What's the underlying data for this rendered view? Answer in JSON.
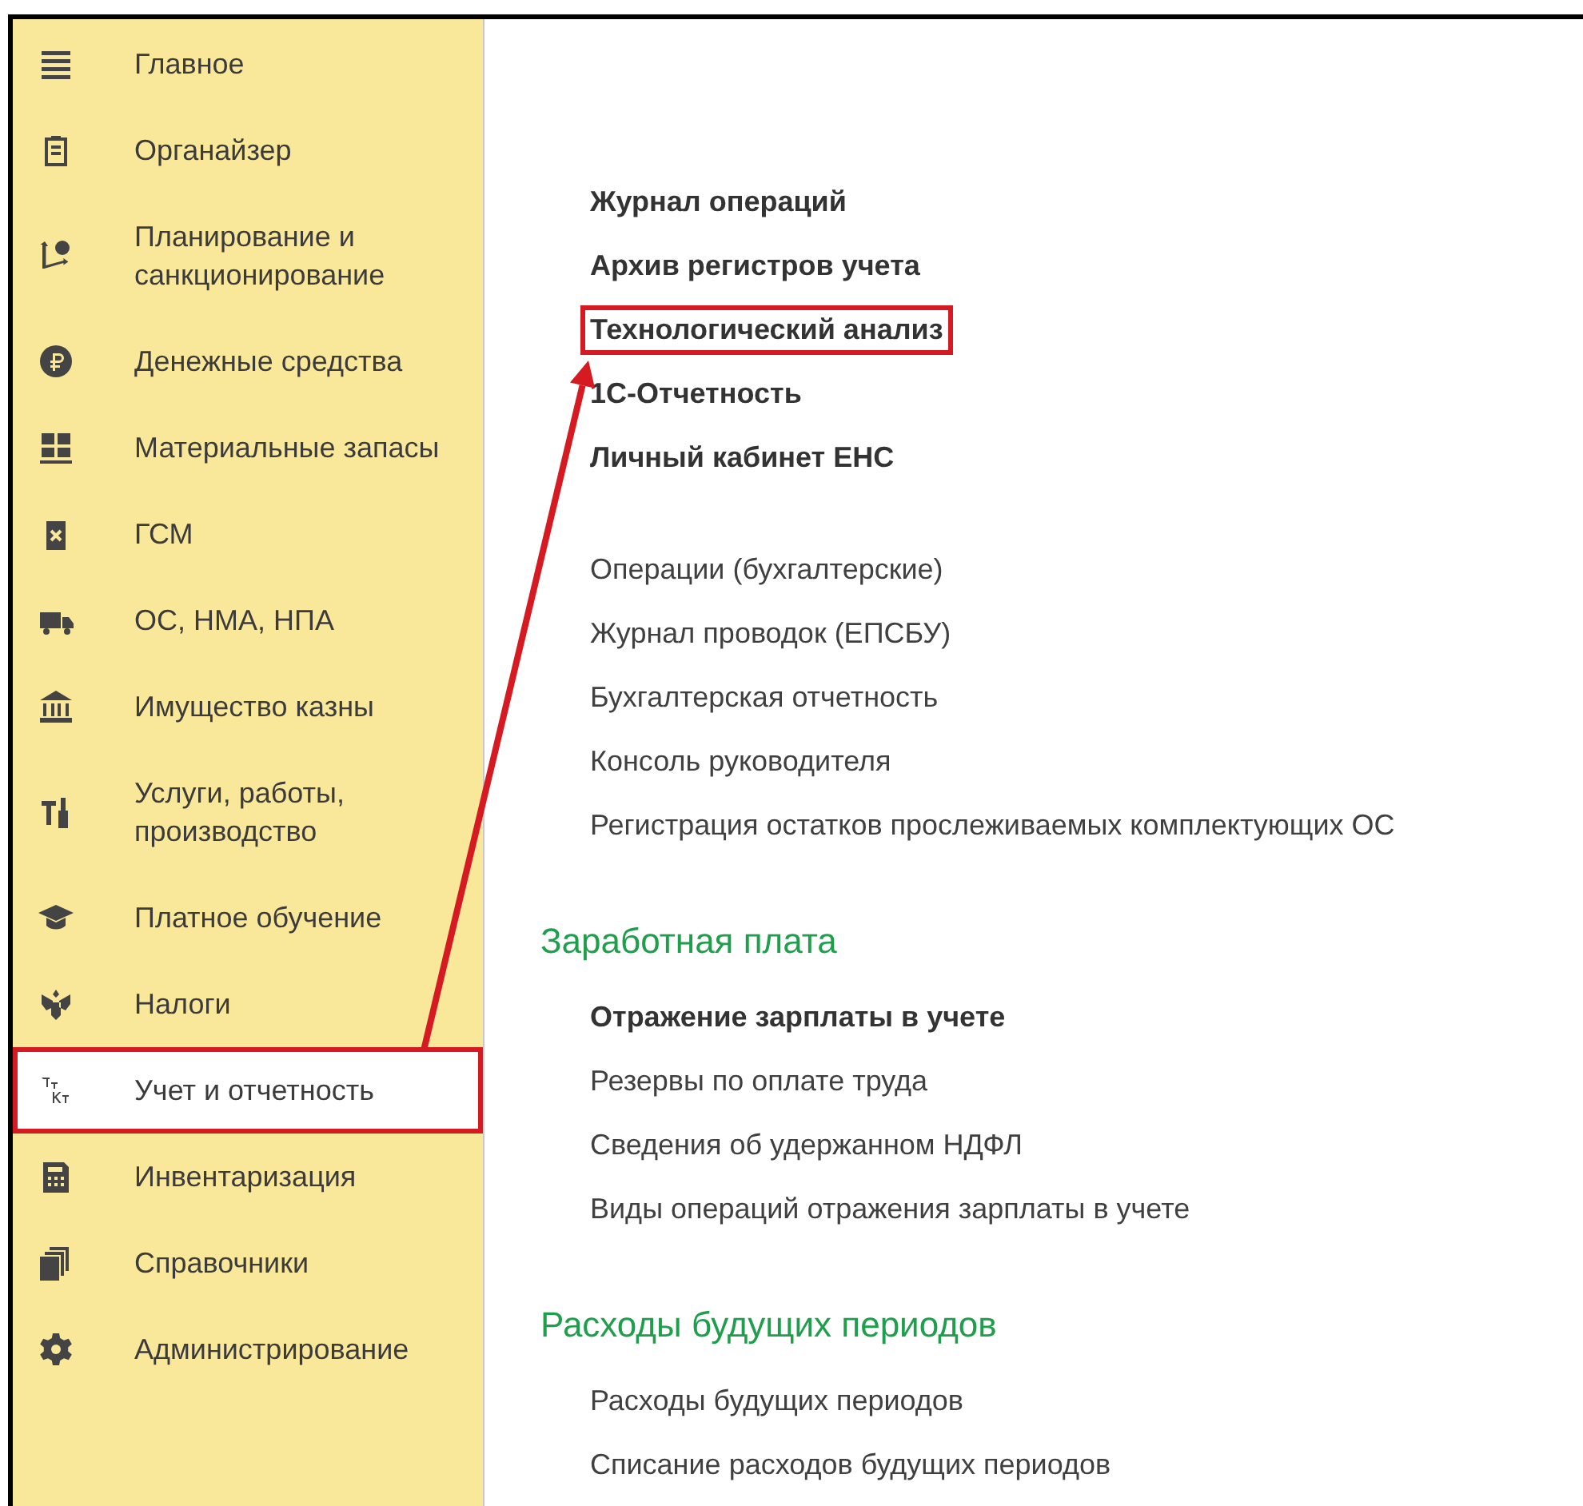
{
  "sidebar": {
    "items": [
      {
        "label": "Главное",
        "selected": false,
        "highlighted": false
      },
      {
        "label": "Органайзер",
        "selected": false,
        "highlighted": false
      },
      {
        "label": "Планирование и санкционирование",
        "selected": false,
        "highlighted": false
      },
      {
        "label": "Денежные средства",
        "selected": false,
        "highlighted": false
      },
      {
        "label": "Материальные запасы",
        "selected": false,
        "highlighted": false
      },
      {
        "label": "ГСМ",
        "selected": false,
        "highlighted": false
      },
      {
        "label": "ОС, НМА, НПА",
        "selected": false,
        "highlighted": false
      },
      {
        "label": "Имущество казны",
        "selected": false,
        "highlighted": false
      },
      {
        "label": "Услуги, работы, производство",
        "selected": false,
        "highlighted": false
      },
      {
        "label": "Платное обучение",
        "selected": false,
        "highlighted": false
      },
      {
        "label": "Налоги",
        "selected": false,
        "highlighted": false
      },
      {
        "label": "Учет и отчетность",
        "selected": true,
        "highlighted": true
      },
      {
        "label": "Инвентаризация",
        "selected": false,
        "highlighted": false
      },
      {
        "label": "Справочники",
        "selected": false,
        "highlighted": false
      },
      {
        "label": "Администрирование",
        "selected": false,
        "highlighted": false
      }
    ]
  },
  "content": {
    "sections": [
      {
        "items": [
          {
            "label": "Журнал операций",
            "bold": true,
            "highlighted": false
          },
          {
            "label": "Архив регистров учета",
            "bold": true,
            "highlighted": false
          },
          {
            "label": "Технологический анализ",
            "bold": true,
            "highlighted": true
          },
          {
            "label": "1С-Отчетность",
            "bold": true,
            "highlighted": false
          },
          {
            "label": "Личный кабинет ЕНС",
            "bold": true,
            "highlighted": false
          }
        ]
      },
      {
        "items": [
          {
            "label": "Операции (бухгалтерские)",
            "bold": false,
            "highlighted": false
          },
          {
            "label": "Журнал проводок (ЕПСБУ)",
            "bold": false,
            "highlighted": false
          },
          {
            "label": "Бухгалтерская отчетность",
            "bold": false,
            "highlighted": false
          },
          {
            "label": "Консоль руководителя",
            "bold": false,
            "highlighted": false
          },
          {
            "label": "Регистрация остатков прослеживаемых комплектующих ОС",
            "bold": false,
            "highlighted": false
          }
        ]
      },
      {
        "title": "Заработная плата",
        "items": [
          {
            "label": "Отражение зарплаты в учете",
            "bold": true,
            "highlighted": false
          },
          {
            "label": "Резервы по оплате труда",
            "bold": false,
            "highlighted": false
          },
          {
            "label": "Сведения об удержанном НДФЛ",
            "bold": false,
            "highlighted": false
          },
          {
            "label": "Виды операций отражения зарплаты в учете",
            "bold": false,
            "highlighted": false
          }
        ]
      },
      {
        "title": "Расходы будущих периодов",
        "items": [
          {
            "label": "Расходы будущих периодов",
            "bold": false,
            "highlighted": false
          },
          {
            "label": "Списание расходов будущих периодов",
            "bold": false,
            "highlighted": false
          }
        ]
      }
    ]
  }
}
